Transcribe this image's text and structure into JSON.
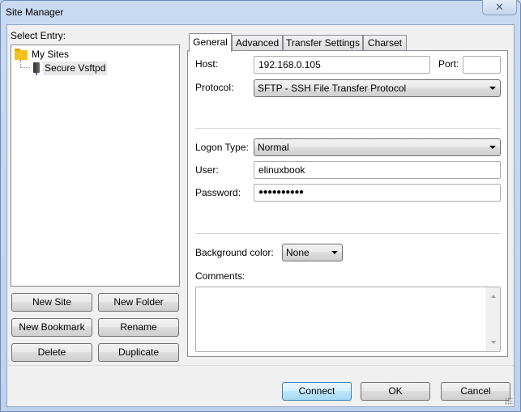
{
  "window": {
    "title": "Site Manager",
    "close_label": "✕"
  },
  "left": {
    "select_entry_label": "Select Entry:",
    "tree": [
      {
        "label": "My Sites",
        "icon": "folder-icon",
        "selected": false
      },
      {
        "label": "Secure Vsftpd",
        "icon": "server-icon",
        "selected": true
      }
    ],
    "buttons": {
      "new_site": "New Site",
      "new_folder": "New Folder",
      "new_bookmark": "New Bookmark",
      "rename": "Rename",
      "delete": "Delete",
      "duplicate": "Duplicate"
    }
  },
  "tabs": [
    {
      "label": "General",
      "active": true
    },
    {
      "label": "Advanced",
      "active": false
    },
    {
      "label": "Transfer Settings",
      "active": false
    },
    {
      "label": "Charset",
      "active": false
    }
  ],
  "general": {
    "host_label": "Host:",
    "host_value": "192.168.0.105",
    "port_label": "Port:",
    "port_value": "",
    "protocol_label": "Protocol:",
    "protocol_value": "SFTP - SSH File Transfer Protocol",
    "logon_type_label": "Logon Type:",
    "logon_type_value": "Normal",
    "user_label": "User:",
    "user_value": "elinuxbook",
    "password_label": "Password:",
    "password_value": "●●●●●●●●●●",
    "background_color_label": "Background color:",
    "background_color_value": "None",
    "comments_label": "Comments:",
    "comments_value": ""
  },
  "footer": {
    "connect": "Connect",
    "ok": "OK",
    "cancel": "Cancel"
  }
}
